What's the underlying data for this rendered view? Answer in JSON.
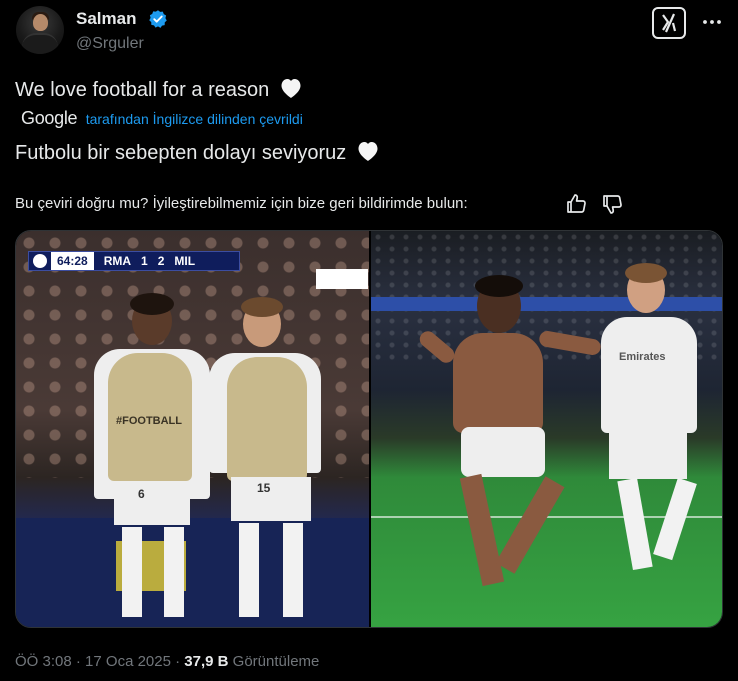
{
  "author": {
    "name": "Salman",
    "handle": "@Srguler",
    "verified_color": "#1d9bf0"
  },
  "tweet": {
    "text": "We love football for a reason",
    "google_logo": "Google",
    "translated_by": "tarafından İngilizce dilinden çevrildi",
    "translation": "Futbolu bir sebepten dolayı seviyoruz",
    "feedback": "Bu çeviri doğru mu? İyileştirebilmemiz için bize geri bildirimde bulun:",
    "emoji": "white-heart"
  },
  "media": {
    "left_photo": {
      "scorebug": {
        "clock": "64:28",
        "home": "RMA",
        "home_score": "1",
        "away_score": "2",
        "away": "MIL"
      },
      "vest_text": "#FOOTBALL",
      "numbers": [
        "6",
        "15"
      ]
    },
    "right_photo": {
      "shirt_text": "Emirates"
    }
  },
  "meta": {
    "time": "ÖÖ 3:08",
    "date": "17 Oca 2025",
    "views": "37,9 B",
    "views_label": "Görüntüleme"
  },
  "icons": [
    "verified-badge-icon",
    "grok-icon",
    "more-icon",
    "thumbs-up-icon",
    "thumbs-down-icon",
    "heart-icon"
  ],
  "colors": {
    "background": "#000000",
    "text": "#e7e9ea",
    "secondary_text": "#71767b",
    "link": "#1d9bf0"
  }
}
